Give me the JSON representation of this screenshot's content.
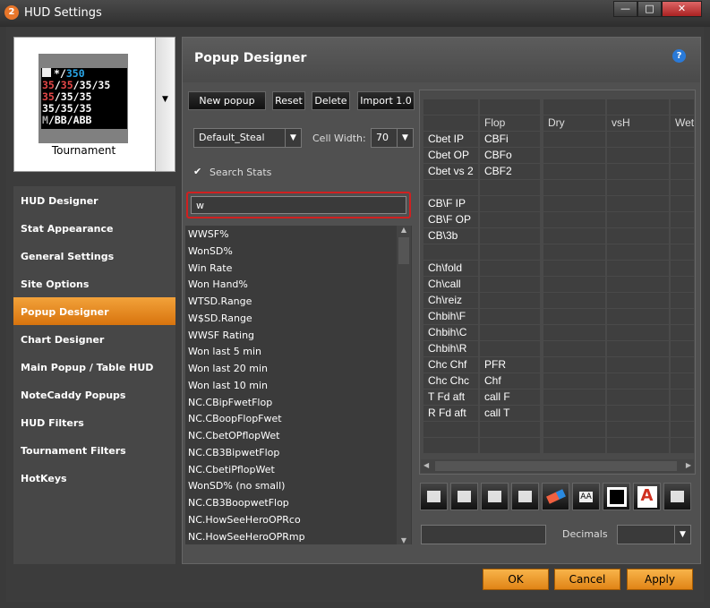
{
  "window": {
    "title": "HUD Settings",
    "app_icon": "2",
    "minimize": "—",
    "maximize": "□",
    "close": "✕"
  },
  "preview": {
    "hud_lines": [
      [
        "*",
        "/",
        "350"
      ],
      [
        "35",
        "/",
        "35",
        "/",
        "35",
        "/",
        "35"
      ],
      [
        "35",
        "/",
        "35",
        "/",
        "35"
      ],
      [
        "35",
        "/",
        "35",
        "/",
        "35"
      ],
      [
        "M",
        "/",
        "BB",
        "/",
        "ABB"
      ]
    ],
    "label": "Tournament"
  },
  "nav": {
    "items": [
      "HUD Designer",
      "Stat Appearance",
      "General Settings",
      "Site Options",
      "Popup Designer",
      "Chart Designer",
      "Main Popup / Table HUD",
      "NoteCaddy Popups",
      "HUD Filters",
      "Tournament Filters",
      "HotKeys"
    ],
    "active": 4
  },
  "panel": {
    "title": "Popup Designer",
    "help": "?",
    "buttons": {
      "new": "New popup",
      "reset": "Reset",
      "delete": "Delete",
      "import": "Import 1.0"
    },
    "popup_select": "Default_Steal",
    "cell_width_label": "Cell Width:",
    "cell_width": "70",
    "search_stats_label": "Search Stats",
    "search_value": "w",
    "stats": [
      "WWSF%",
      "WonSD%",
      "Win Rate",
      "Won Hand%",
      "WTSD.Range",
      "W$SD.Range",
      "WWSF Rating",
      "Won last 5 min",
      "Won last 20 min",
      "Won last 10 min",
      "NC.CBipFwetFlop",
      "NC.CBoopFlopFwet",
      "NC.CbetOPflopWet",
      "NC.CB3BipwetFlop",
      "NC.CbetiPflopWet",
      "WonSD% (no small)",
      "NC.CB3BoopwetFlop",
      "NC.HowSeeHeroOPRco",
      "NC.HowSeeHeroOPRmp"
    ],
    "grid": [
      [
        "",
        "",
        "",
        "",
        ""
      ],
      [
        "",
        "Flop",
        "Dry",
        "vsH",
        "Wet"
      ],
      [
        "Cbet IP",
        "CBFi",
        "",
        "",
        ""
      ],
      [
        "Cbet OP",
        "CBFo",
        "",
        "",
        ""
      ],
      [
        "Cbet vs 2",
        "CBF2",
        "",
        "",
        ""
      ],
      [
        "",
        "",
        "",
        "",
        ""
      ],
      [
        "CB\\F IP",
        "",
        "",
        "",
        ""
      ],
      [
        "CB\\F OP",
        "",
        "",
        "",
        ""
      ],
      [
        "CB\\3b",
        "",
        "",
        "",
        ""
      ],
      [
        "",
        "",
        "",
        "",
        ""
      ],
      [
        "Ch\\fold",
        "",
        "",
        "",
        ""
      ],
      [
        "Ch\\call",
        "",
        "",
        "",
        ""
      ],
      [
        "Ch\\reiz",
        "",
        "",
        "",
        ""
      ],
      [
        "Chbih\\F",
        "",
        "",
        "",
        ""
      ],
      [
        "Chbih\\C",
        "",
        "",
        "",
        ""
      ],
      [
        "Chbih\\R",
        "",
        "",
        "",
        ""
      ],
      [
        "Chc  Chf",
        "PFR",
        "",
        "",
        ""
      ],
      [
        "Chc Chc",
        "Chf",
        "",
        "",
        ""
      ],
      [
        "T Fd aft",
        "call F",
        "",
        "",
        ""
      ],
      [
        "R Fd aft",
        "call T",
        "",
        "",
        ""
      ],
      [
        "",
        "",
        "",
        "",
        ""
      ],
      [
        "",
        "",
        "",
        "",
        ""
      ]
    ],
    "decimals_label": "Decimals",
    "aa_label": "AA"
  },
  "footer": {
    "ok": "OK",
    "cancel": "Cancel",
    "apply": "Apply"
  }
}
